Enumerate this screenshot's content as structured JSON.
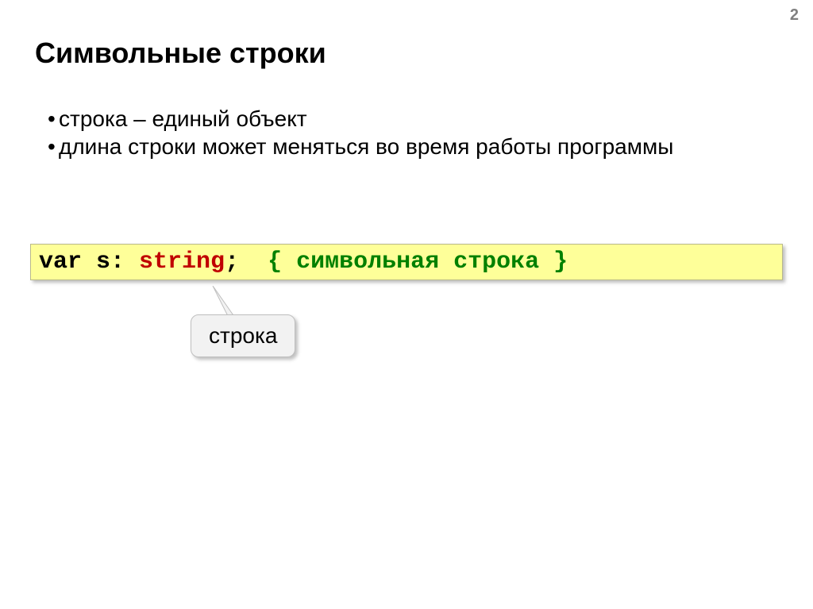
{
  "page_number": "2",
  "title": "Символьные строки",
  "bullets": [
    "строка – единый объект",
    "длина строки может меняться во время работы программы"
  ],
  "code": {
    "var": "var",
    "name": " s: ",
    "type": "string",
    "semi": ";  ",
    "comment": "{ символьная строка }"
  },
  "callout": "строка"
}
